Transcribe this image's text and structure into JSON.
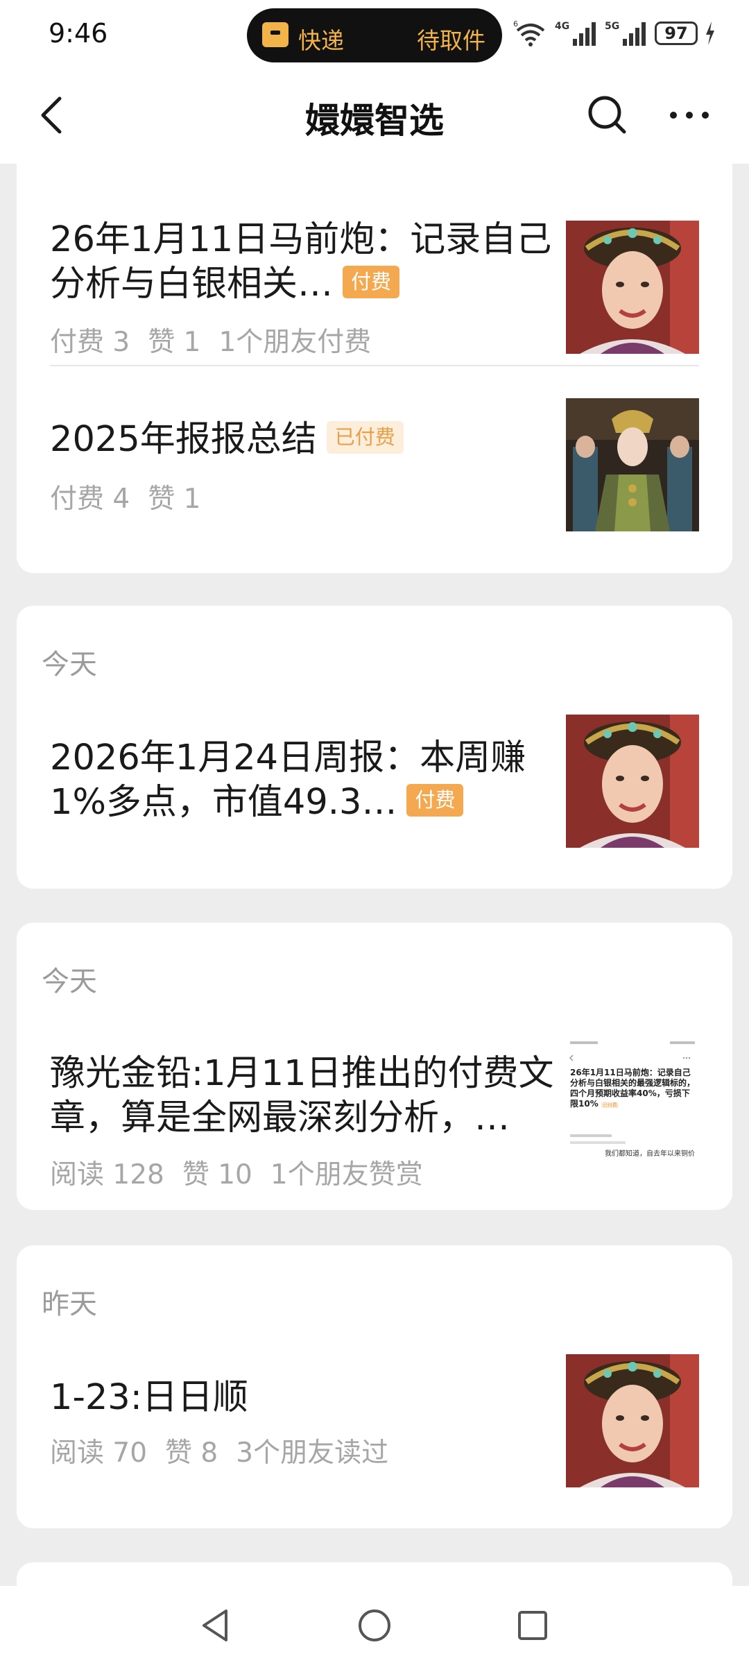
{
  "status_bar": {
    "time": "9:46",
    "express_label": "快递",
    "pickup_label": "待取件",
    "wifi_tag": "6",
    "network_1": "4G",
    "network_2": "5G",
    "battery": "97",
    "accent_color": "#f1b34a"
  },
  "header": {
    "title": "嬛嬛智选",
    "back_icon": "chevron-left-icon",
    "search_icon": "search-icon",
    "more_icon": "more-dots-icon"
  },
  "cards": [
    {
      "articles": [
        {
          "title": "26年1月11日马前炮：记录自己分析与白银相关…",
          "tag": "付费",
          "meta": [
            "付费 3",
            "赞 1",
            "1个朋友付费"
          ]
        },
        {
          "title": "2025年报报总结",
          "tag": "已付费",
          "meta": [
            "付费 4",
            "赞 1"
          ]
        }
      ]
    },
    {
      "label": "今天",
      "articles": [
        {
          "title": "2026年1月24日周报：本周赚1%多点，市值49.3…",
          "tag": "付费"
        }
      ]
    },
    {
      "label": "今天",
      "articles": [
        {
          "title": "豫光金铅:1月11日推出的付费文章，算是全网最深刻分析，…",
          "meta": [
            "阅读 128",
            "赞 10",
            "1个朋友赞赏"
          ],
          "thumb_text": {
            "title": "26年1月11日马前炮：记录自己分析与白银相关的最强逻辑标的，四个月预期收益率40%，亏损下限10%",
            "tag": "已付费",
            "body": "我们都知道，自去年以来铜价"
          }
        }
      ]
    },
    {
      "label": "昨天",
      "articles": [
        {
          "title": "1-23:日日顺",
          "meta": [
            "阅读 70",
            "赞 8",
            "3个朋友读过"
          ]
        }
      ]
    }
  ],
  "navbar": {
    "back_icon": "triangle-back-icon",
    "home_icon": "circle-home-icon",
    "recents_icon": "square-recents-icon"
  }
}
